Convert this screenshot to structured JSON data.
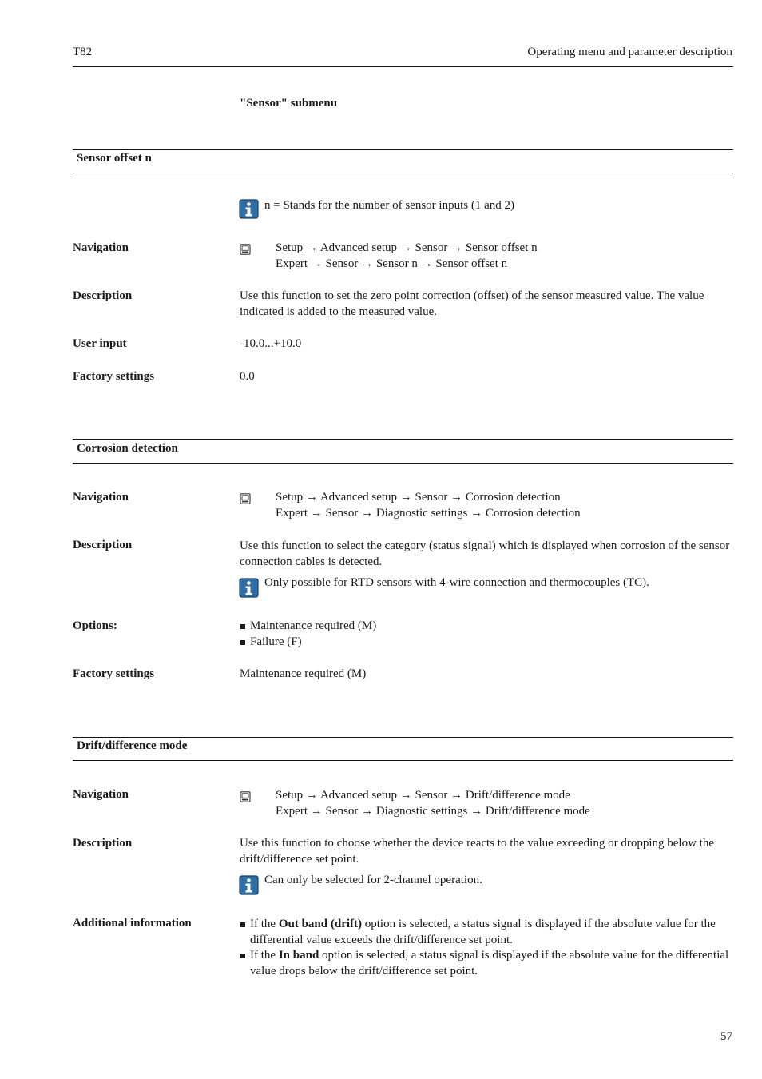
{
  "header": {
    "left": "T82",
    "right": "Operating menu and parameter description"
  },
  "submenu_title": "\"Sensor\" submenu",
  "icons": {
    "info": "info-icon",
    "navigation": "display-operation-icon"
  },
  "colors": {
    "info_icon_fill": "#2f6ea5",
    "info_icon_border": "#1c3f60"
  },
  "sections": [
    {
      "title": "Sensor offset n",
      "note": "n = Stands for the number of sensor inputs (1 and 2)",
      "navigation_label": "Navigation",
      "navigation": [
        "Setup → Advanced setup → Sensor → Sensor offset n",
        "Expert → Sensor → Sensor n → Sensor offset n"
      ],
      "description_label": "Description",
      "description": "Use this function to set the zero point correction (offset) of the sensor measured value. The value indicated is added to the measured value.",
      "user_input_label": "User input",
      "user_input": "-10.0...+10.0",
      "factory_label": "Factory settings",
      "factory": "0.0"
    },
    {
      "title": "Corrosion detection",
      "navigation_label": "Navigation",
      "navigation": [
        "Setup → Advanced setup → Sensor → Corrosion detection",
        "Expert → Sensor → Diagnostic settings → Corrosion detection"
      ],
      "description_label": "Description",
      "description": "Use this function to select the category (status signal) which is displayed when corrosion of the sensor connection cables is detected.",
      "note": "Only possible for RTD sensors with 4-wire connection and thermocouples (TC).",
      "options_label": "Options:",
      "options": [
        "Maintenance required (M)",
        "Failure (F)"
      ],
      "factory_label": "Factory settings",
      "factory": "Maintenance required (M)"
    },
    {
      "title": "Drift/difference mode",
      "navigation_label": "Navigation",
      "navigation": [
        "Setup → Advanced setup → Sensor → Drift/difference mode",
        "Expert → Sensor → Diagnostic settings → Drift/difference mode"
      ],
      "description_label": "Description",
      "description": "Use this function to choose whether the device reacts to the value exceeding or dropping below the drift/difference set point.",
      "note": "Can only be selected for 2-channel operation.",
      "additional_label": "Additional information",
      "additional": [
        {
          "prefix": "If the ",
          "bold": "Out band (drift)",
          "suffix": " option is selected, a status signal is displayed if the absolute value for the differential value exceeds the drift/difference set point."
        },
        {
          "prefix": "If the ",
          "bold": "In band",
          "suffix": " option is selected, a status signal is displayed if the absolute value for the differential value drops below the drift/difference set point."
        }
      ]
    }
  ],
  "page_number": "57"
}
